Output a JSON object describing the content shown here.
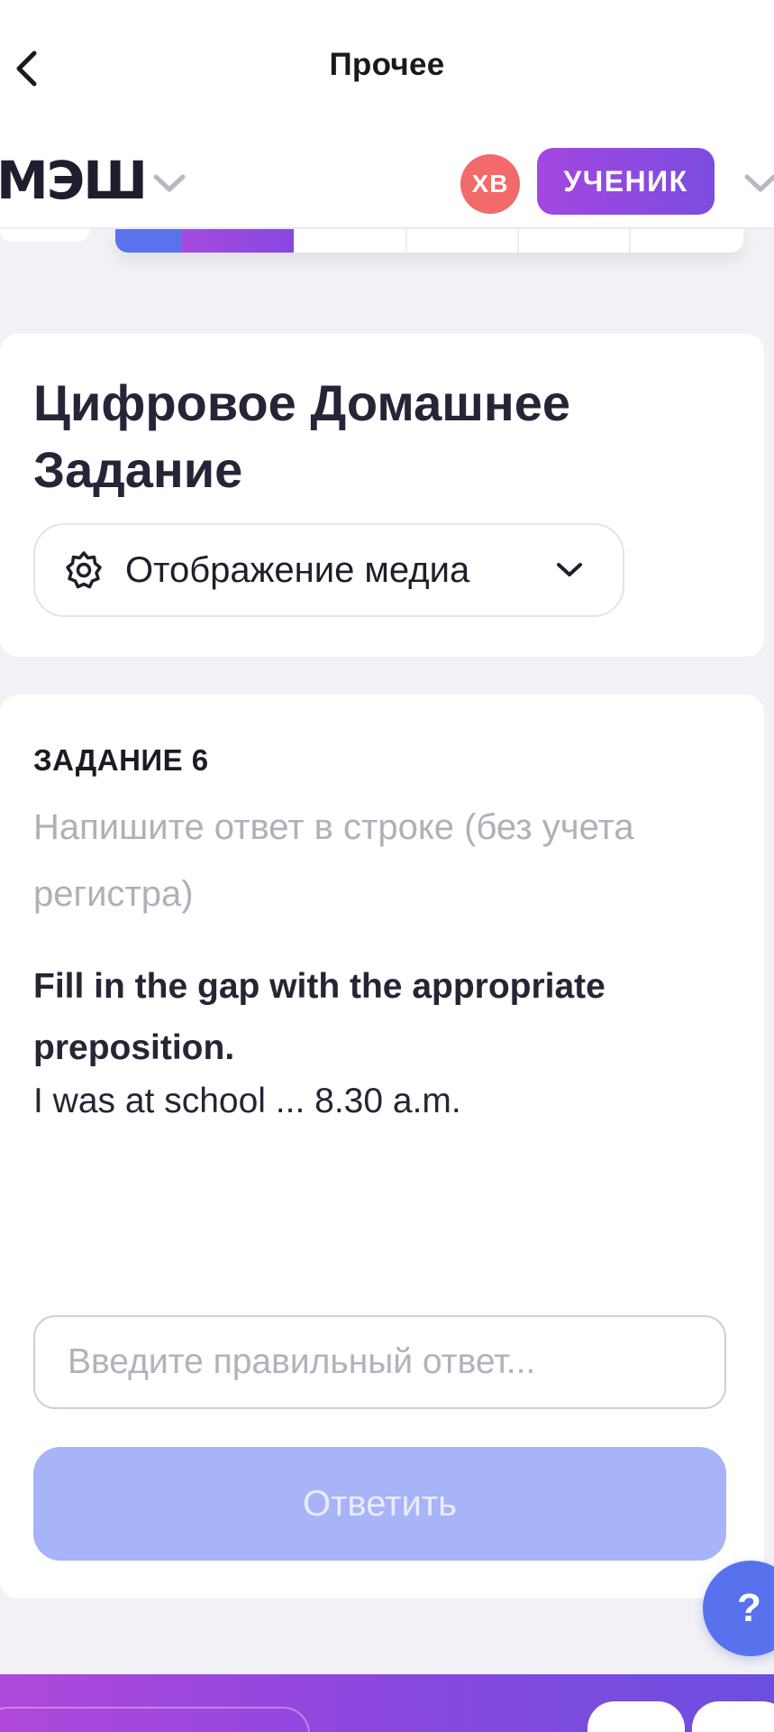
{
  "nav": {
    "title": "Прочее",
    "back_icon": "chevron-left-icon"
  },
  "header": {
    "brand": "МЭШ",
    "brand_menu_icon": "chevron-down-icon",
    "avatar_initials": "ХВ",
    "avatar_color": "#f36a6a",
    "role": "УЧЕНИК",
    "role_menu_icon": "chevron-down-icon",
    "role_gradient": [
      "#a347e0",
      "#7b4ce0"
    ]
  },
  "main": {
    "title": "Цифровое Домашнее Задание",
    "media_toggle": {
      "icon": "gear-icon",
      "label": "Отображение медиа",
      "chevron_icon": "chevron-down-icon"
    }
  },
  "task": {
    "number_label": "ЗАДАНИЕ 6",
    "hint": "Напишите ответ в строке (без учета регистра)",
    "question": "Fill in the gap with the appropriate preposition.",
    "sentence": "I was at school ... 8.30 a.m.",
    "answer": {
      "value": "",
      "placeholder": "Введите правильный ответ..."
    },
    "submit_label": "Ответить",
    "submit_color": "#a7b4f7"
  },
  "help": {
    "label": "?",
    "color": "#5872ee"
  },
  "bottom_bar": {
    "gradient": [
      "#b048dc",
      "#8a47de",
      "#6c4fe0"
    ]
  }
}
